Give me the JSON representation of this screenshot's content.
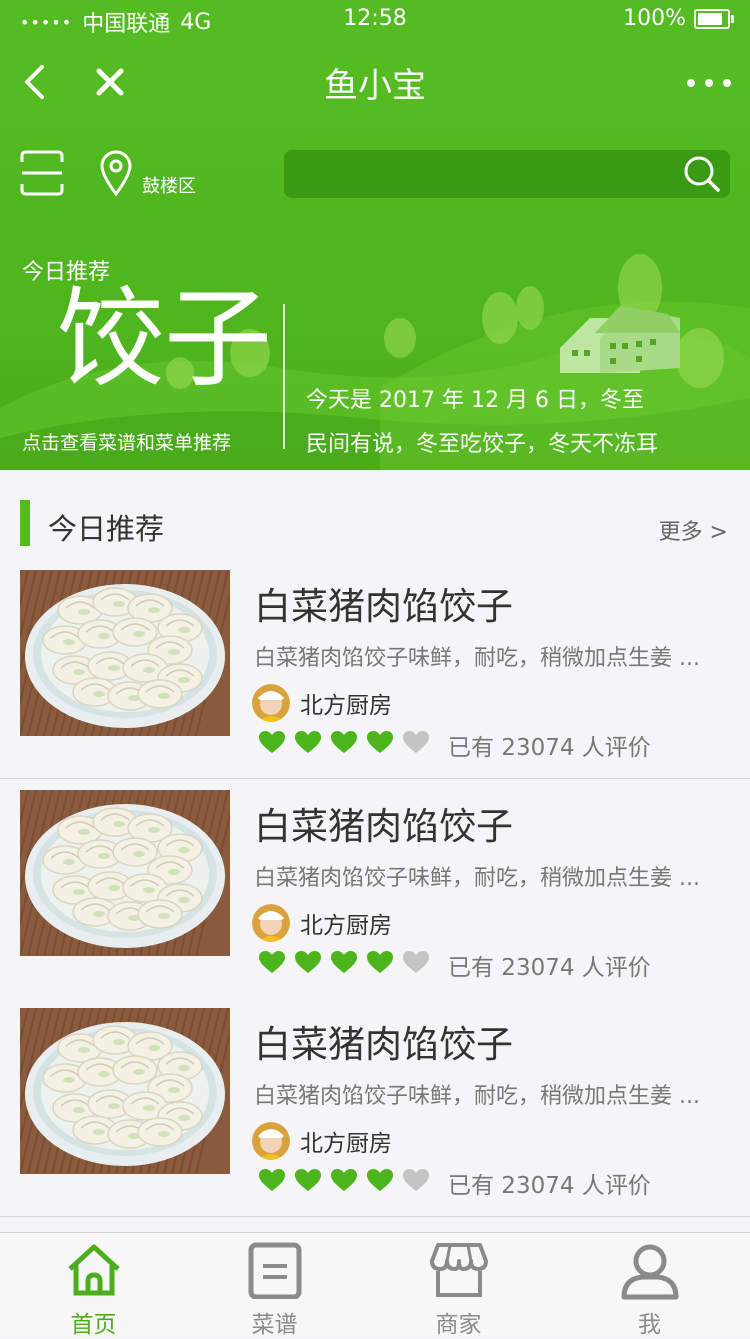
{
  "status_bar": {
    "signal": "•••••",
    "carrier": "中国联通",
    "network": "4G",
    "time": "12:58",
    "battery_text": "100%",
    "battery_level": 1.0
  },
  "nav": {
    "title": "鱼小宝",
    "back_icon": "back-arrow-icon",
    "close_icon": "close-icon",
    "more_icon": "more-dots-icon"
  },
  "header": {
    "location": "鼓楼区",
    "scan_icon": "scan-icon",
    "location_icon": "location-pin-icon",
    "search_icon": "search-icon",
    "search_placeholder": ""
  },
  "hero": {
    "label": "今日推荐",
    "dish": "饺子",
    "subtitle": "点击查看菜谱和菜单推荐",
    "line1": "今天是 2017 年 12 月 6 日，冬至",
    "line2": "民间有说，冬至吃饺子，冬天不冻耳"
  },
  "section": {
    "title": "今日推荐",
    "more": "更多 >"
  },
  "items": [
    {
      "name": "白菜猪肉馅饺子",
      "desc": "白菜猪肉馅饺子味鲜，耐吃，稍微加点生姜 ...",
      "shop": "北方厨房",
      "rating": 4,
      "rating_max": 5,
      "reviews": "已有 23074 人评价"
    },
    {
      "name": "白菜猪肉馅饺子",
      "desc": "白菜猪肉馅饺子味鲜，耐吃，稍微加点生姜 ...",
      "shop": "北方厨房",
      "rating": 4,
      "rating_max": 5,
      "reviews": "已有 23074 人评价"
    },
    {
      "name": "白菜猪肉馅饺子",
      "desc": "白菜猪肉馅饺子味鲜，耐吃，稍微加点生姜 ...",
      "shop": "北方厨房",
      "rating": 4,
      "rating_max": 5,
      "reviews": "已有 23074 人评价"
    }
  ],
  "tabs": [
    {
      "label": "首页",
      "icon": "home-icon",
      "active": true
    },
    {
      "label": "菜谱",
      "icon": "recipe-icon",
      "active": false
    },
    {
      "label": "商家",
      "icon": "store-icon",
      "active": false
    },
    {
      "label": "我",
      "icon": "user-icon",
      "active": false
    }
  ],
  "colors": {
    "primary": "#55bb22",
    "heart_on": "#4cb51c",
    "heart_off": "#c4c4c4",
    "text": "#333333",
    "muted": "#777777"
  }
}
